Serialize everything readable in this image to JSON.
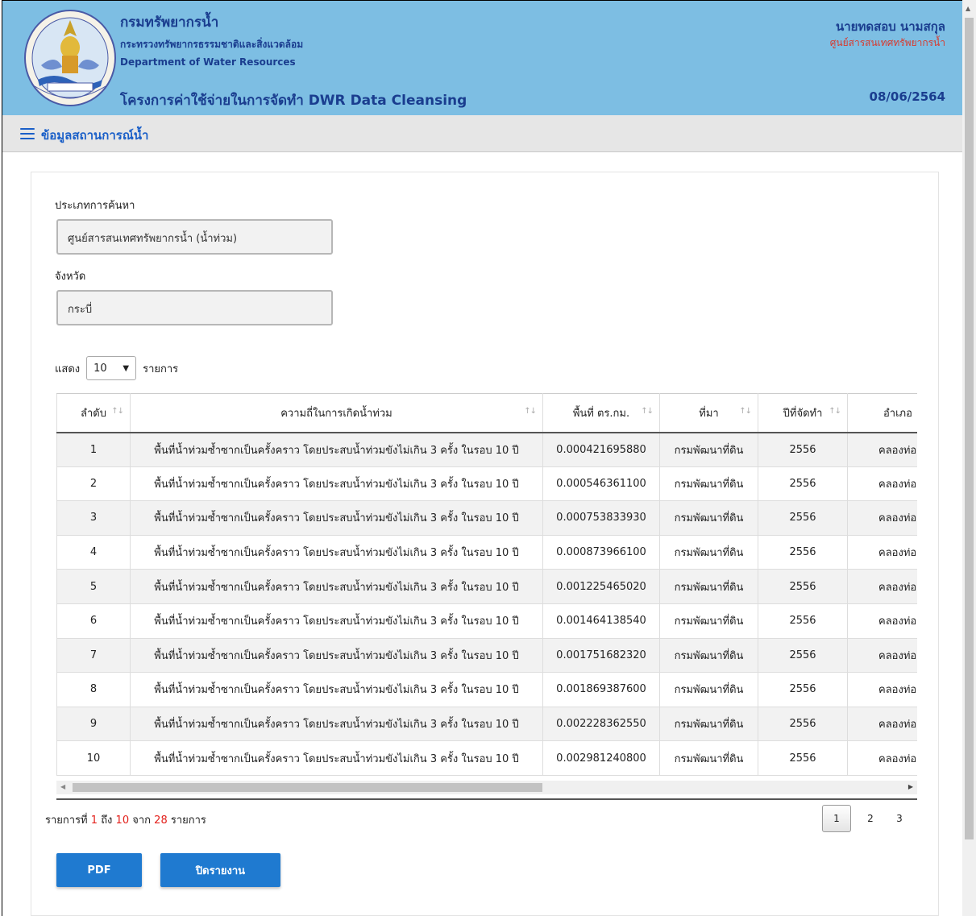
{
  "header": {
    "org_name": "กรมทรัพยากรน้ำ",
    "ministry": "กระทรวงทรัพยากรธรรมชาติและสิ่งแวดล้อม",
    "org_name_en": "Department of Water Resources",
    "project_title": "โครงการค่าใช้จ่ายในการจัดทำ DWR Data Cleansing",
    "user_name": "นายทดสอบ นามสกุล",
    "user_dept": "ศูนย์สารสนเทศทรัพยากรน้ำ",
    "date": "08/06/2564",
    "logo_icon": "dwr-seal-logo",
    "colors": {
      "header_bg": "#7dbee3",
      "title": "#1a3d8f",
      "dept": "#d83a2e"
    }
  },
  "nav": {
    "menu_icon": "hamburger-icon",
    "title": "ข้อมูลสถานการณ์น้ำ"
  },
  "filters": {
    "search_type_label": "ประเภทการค้นหา",
    "search_type_value": "ศูนย์สารสนเทศทรัพยากรน้ำ (น้ำท่วม)",
    "province_label": "จังหวัด",
    "province_value": "กระบี่"
  },
  "length": {
    "prefix": "แสดง",
    "value": "10",
    "suffix": "รายการ"
  },
  "table": {
    "columns": [
      "ลำดับ",
      "ความถี่ในการเกิดน้ำท่วม",
      "พื้นที่ ตร.กม.",
      "ที่มา",
      "ปีที่จัดทำ",
      "อำเภอ"
    ],
    "rows": [
      [
        "1",
        "พื้นที่น้ำท่วมซ้ำซากเป็นครั้งคราว โดยประสบน้ำท่วมขังไม่เกิน 3 ครั้ง ในรอบ 10 ปี",
        "0.000421695880",
        "กรมพัฒนาที่ดิน",
        "2556",
        "คลองท่อม"
      ],
      [
        "2",
        "พื้นที่น้ำท่วมซ้ำซากเป็นครั้งคราว โดยประสบน้ำท่วมขังไม่เกิน 3 ครั้ง ในรอบ 10 ปี",
        "0.000546361100",
        "กรมพัฒนาที่ดิน",
        "2556",
        "คลองท่อม"
      ],
      [
        "3",
        "พื้นที่น้ำท่วมซ้ำซากเป็นครั้งคราว โดยประสบน้ำท่วมขังไม่เกิน 3 ครั้ง ในรอบ 10 ปี",
        "0.000753833930",
        "กรมพัฒนาที่ดิน",
        "2556",
        "คลองท่อม"
      ],
      [
        "4",
        "พื้นที่น้ำท่วมซ้ำซากเป็นครั้งคราว โดยประสบน้ำท่วมขังไม่เกิน 3 ครั้ง ในรอบ 10 ปี",
        "0.000873966100",
        "กรมพัฒนาที่ดิน",
        "2556",
        "คลองท่อม"
      ],
      [
        "5",
        "พื้นที่น้ำท่วมซ้ำซากเป็นครั้งคราว โดยประสบน้ำท่วมขังไม่เกิน 3 ครั้ง ในรอบ 10 ปี",
        "0.001225465020",
        "กรมพัฒนาที่ดิน",
        "2556",
        "คลองท่อม"
      ],
      [
        "6",
        "พื้นที่น้ำท่วมซ้ำซากเป็นครั้งคราว โดยประสบน้ำท่วมขังไม่เกิน 3 ครั้ง ในรอบ 10 ปี",
        "0.001464138540",
        "กรมพัฒนาที่ดิน",
        "2556",
        "คลองท่อม"
      ],
      [
        "7",
        "พื้นที่น้ำท่วมซ้ำซากเป็นครั้งคราว โดยประสบน้ำท่วมขังไม่เกิน 3 ครั้ง ในรอบ 10 ปี",
        "0.001751682320",
        "กรมพัฒนาที่ดิน",
        "2556",
        "คลองท่อม"
      ],
      [
        "8",
        "พื้นที่น้ำท่วมซ้ำซากเป็นครั้งคราว โดยประสบน้ำท่วมขังไม่เกิน 3 ครั้ง ในรอบ 10 ปี",
        "0.001869387600",
        "กรมพัฒนาที่ดิน",
        "2556",
        "คลองท่อม"
      ],
      [
        "9",
        "พื้นที่น้ำท่วมซ้ำซากเป็นครั้งคราว โดยประสบน้ำท่วมขังไม่เกิน 3 ครั้ง ในรอบ 10 ปี",
        "0.002228362550",
        "กรมพัฒนาที่ดิน",
        "2556",
        "คลองท่อม"
      ],
      [
        "10",
        "พื้นที่น้ำท่วมซ้ำซากเป็นครั้งคราว โดยประสบน้ำท่วมขังไม่เกิน 3 ครั้ง ในรอบ 10 ปี",
        "0.002981240800",
        "กรมพัฒนาที่ดิน",
        "2556",
        "คลองท่อม"
      ]
    ]
  },
  "info": {
    "prefix": "รายการที่",
    "start": "1",
    "to": "ถึง",
    "end": "10",
    "of": "จาก",
    "total": "28",
    "suffix": "รายการ"
  },
  "pagination": {
    "pages": [
      "1",
      "2",
      "3"
    ],
    "active": "1"
  },
  "buttons": {
    "pdf": "PDF",
    "close_report": "ปิดรายงาน",
    "color": "#1f7ad0"
  }
}
